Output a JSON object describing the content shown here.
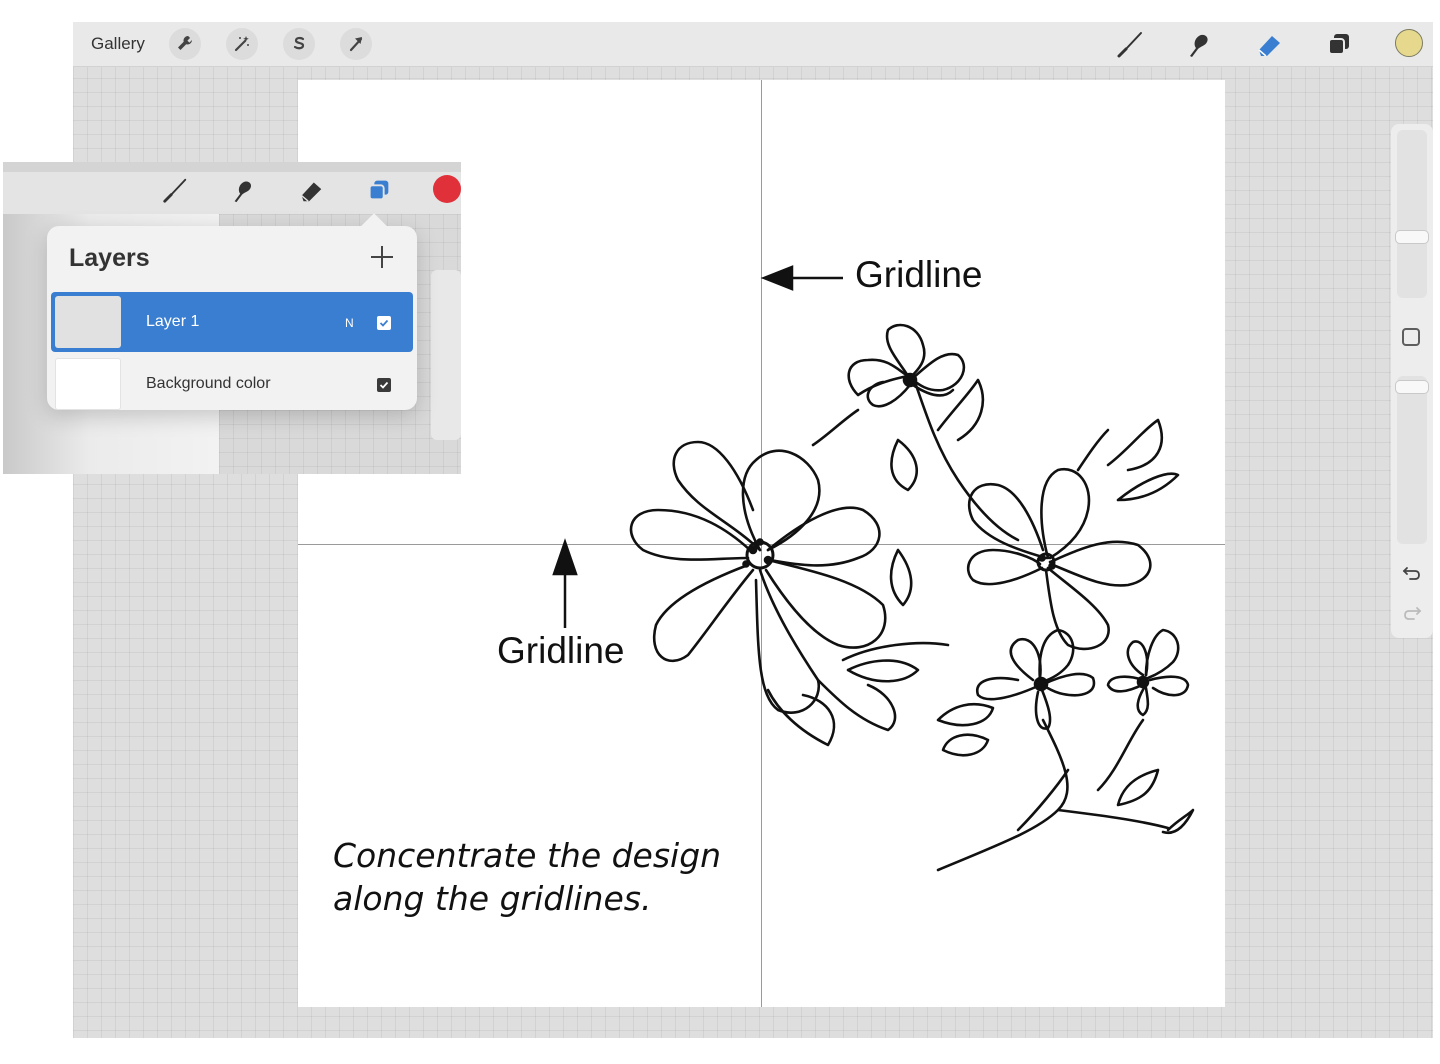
{
  "app": {
    "gallery_label": "Gallery",
    "toolbar_left": [
      "wrench-icon",
      "magic-wand-icon",
      "selection-s-icon",
      "transform-arrow-icon"
    ],
    "toolbar_right": [
      "brush-icon",
      "smudge-icon",
      "eraser-icon",
      "layers-icon"
    ],
    "color_swatch": "#e6d98e",
    "eraser_active_color": "#3a7ed1"
  },
  "canvas": {
    "annotation_vertical_gridline": "Gridline",
    "annotation_horizontal_gridline": "Gridline",
    "caption_line1": "Concentrate the design",
    "caption_line2": "along the gridlines."
  },
  "sidebar": {
    "brush_size_level": 0.65,
    "opacity_level": 0.9
  },
  "inset": {
    "record_color": "#e0303a",
    "layers_title": "Layers",
    "layers": [
      {
        "name": "Layer 1",
        "blend": "N",
        "visible": true,
        "selected": true
      },
      {
        "name": "Background color",
        "blend": "",
        "visible": true,
        "selected": false
      }
    ]
  }
}
